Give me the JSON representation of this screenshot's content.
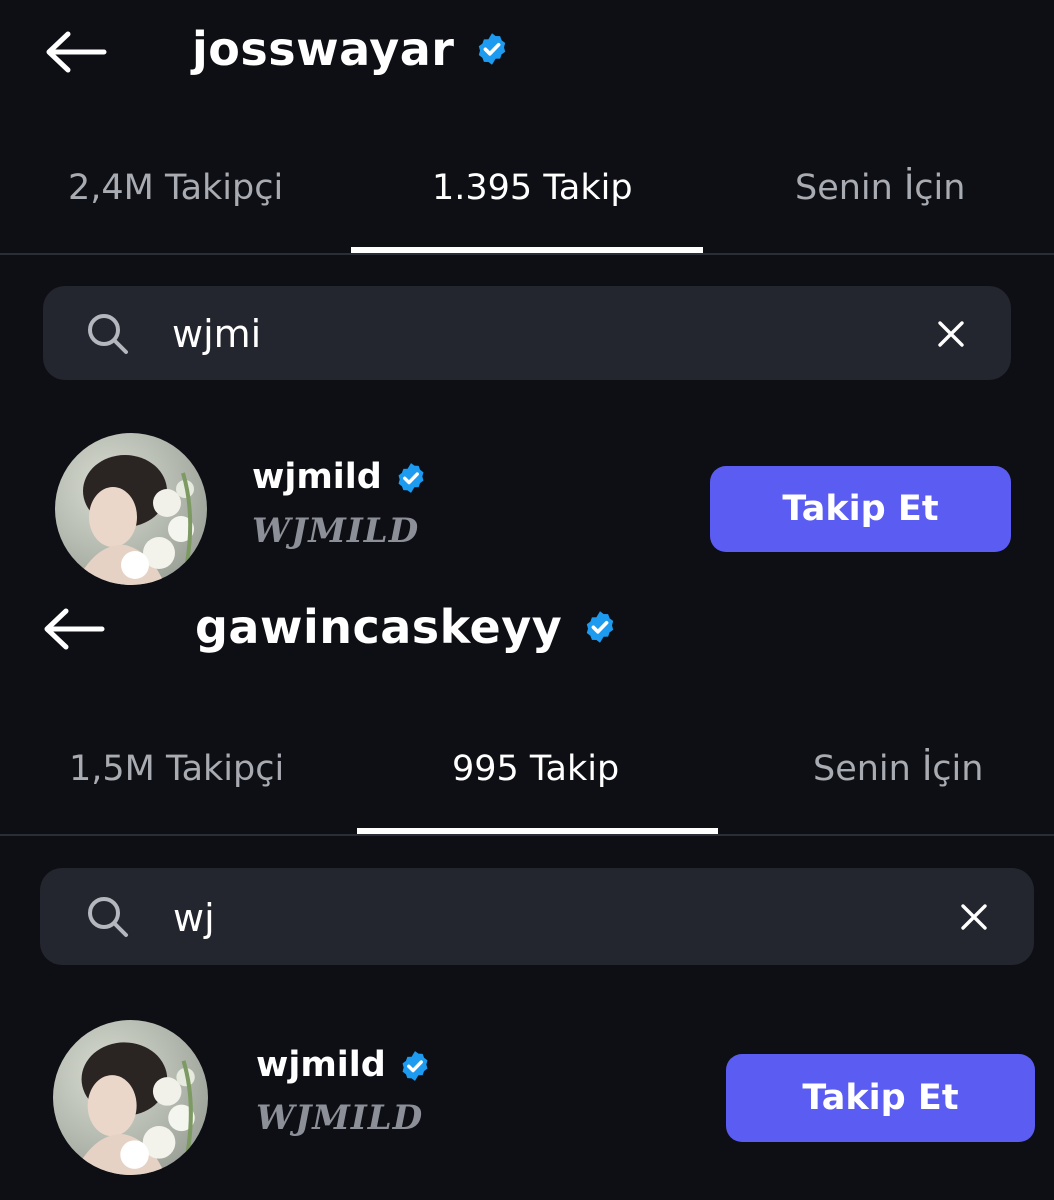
{
  "screens": [
    {
      "title": "josswayar",
      "tabs": [
        {
          "label": "2,4M Takipçi",
          "active": false
        },
        {
          "label": "1.395 Takip",
          "active": true
        },
        {
          "label": "Senin İçin",
          "active": false
        }
      ],
      "search": {
        "query": "wjmi"
      },
      "result": {
        "username": "wjmild",
        "display_name": "WJMILD",
        "button_label": "Takip Et"
      }
    },
    {
      "title": "gawincaskeyy",
      "tabs": [
        {
          "label": "1,5M Takipçi",
          "active": false
        },
        {
          "label": "995 Takip",
          "active": true
        },
        {
          "label": "Senin İçin",
          "active": false
        }
      ],
      "search": {
        "query": "wj"
      },
      "result": {
        "username": "wjmild",
        "display_name": "WJMILD",
        "button_label": "Takip Et"
      }
    }
  ],
  "icons": {
    "back": "arrow-left-icon",
    "verified": "verified-badge-icon",
    "search": "search-icon",
    "clear": "close-icon"
  },
  "colors": {
    "background": "#0d0f14",
    "search_bg": "#23262e",
    "verified": "#1d9bf0",
    "follow_button": "#5a5cf2",
    "inactive_tab": "#a9abb2"
  }
}
